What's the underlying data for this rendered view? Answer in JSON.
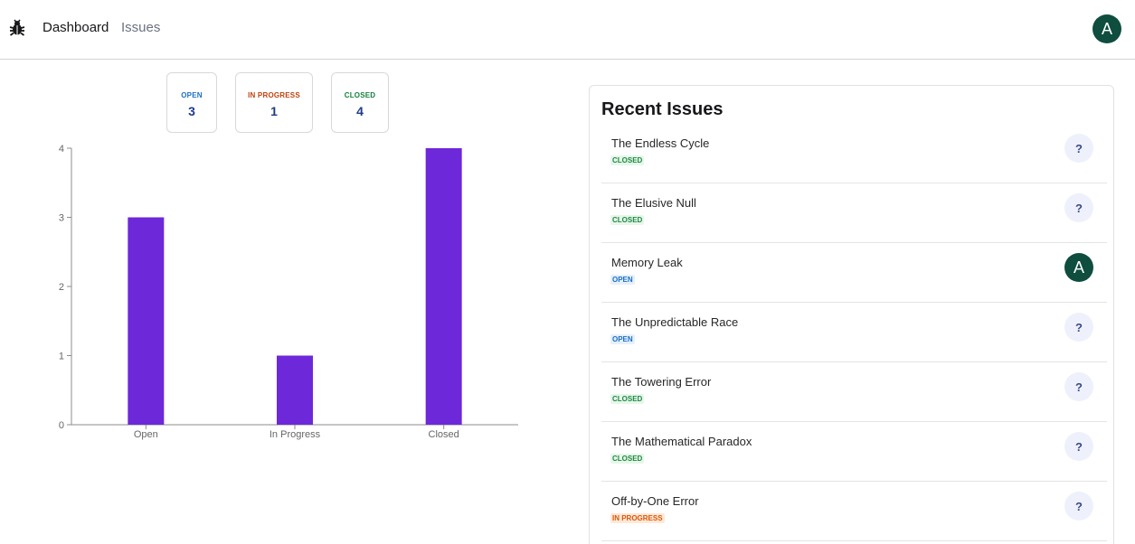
{
  "nav": {
    "logo_icon": "bug-icon",
    "links": [
      {
        "label": "Dashboard",
        "active": true
      },
      {
        "label": "Issues",
        "active": false
      }
    ],
    "avatar_initial": "A"
  },
  "summary": [
    {
      "label": "OPEN",
      "value": "3"
    },
    {
      "label": "IN PROGRESS",
      "value": "1"
    },
    {
      "label": "CLOSED",
      "value": "4"
    }
  ],
  "chart_data": {
    "type": "bar",
    "categories": [
      "Open",
      "In Progress",
      "Closed"
    ],
    "values": [
      3,
      1,
      4
    ],
    "y_ticks": [
      "0",
      "1",
      "2",
      "3",
      "4"
    ],
    "ylim": [
      0,
      4
    ],
    "bar_color": "#6d28d9",
    "grid": false
  },
  "recent_issues": {
    "title": "Recent Issues",
    "items": [
      {
        "title": "The Endless Cycle",
        "status": "CLOSED",
        "assignee": "?"
      },
      {
        "title": "The Elusive Null",
        "status": "CLOSED",
        "assignee": "?"
      },
      {
        "title": "Memory Leak",
        "status": "OPEN",
        "assignee": "A"
      },
      {
        "title": "The Unpredictable Race",
        "status": "OPEN",
        "assignee": "?"
      },
      {
        "title": "The Towering Error",
        "status": "CLOSED",
        "assignee": "?"
      },
      {
        "title": "The Mathematical Paradox",
        "status": "CLOSED",
        "assignee": "?"
      },
      {
        "title": "Off-by-One Error",
        "status": "IN PROGRESS",
        "assignee": "?"
      }
    ]
  },
  "colors": {
    "open": "#1d6fc4",
    "in_progress": "#c2410c",
    "closed": "#15803d",
    "avatar": "#0f4d3e"
  }
}
